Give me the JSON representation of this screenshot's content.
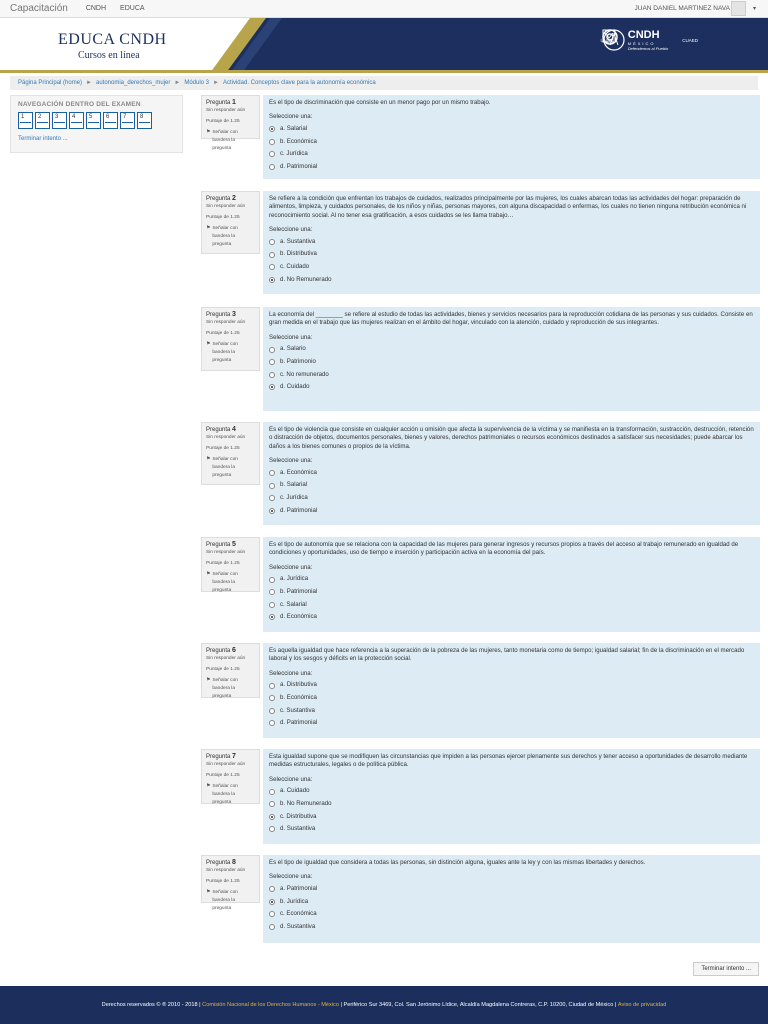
{
  "topbar": {
    "brand": "Capacitación",
    "links": [
      "CNDH",
      "EDUCA"
    ],
    "user": "JUAN DANIEL MARTINEZ NAVA"
  },
  "banner": {
    "title": "EDUCA CNDH",
    "subtitle": "Cursos en línea",
    "logos": [
      "UNAM",
      "CNDH",
      "MÉXICO",
      "Defendemos al Pueblo",
      "CUAED"
    ],
    "accent": "#b8a44a",
    "navy": "#1d2f5e"
  },
  "breadcrumb": [
    "Página Principal (home)",
    "autonomia_derechos_mujer",
    "Módulo 3",
    "Actividad. Conceptos clave para la autonomía económica"
  ],
  "quiznav": {
    "title": "NAVEGACIÓN DENTRO DEL EXAMEN",
    "buttons": [
      "1",
      "2",
      "3",
      "4",
      "5",
      "6",
      "7",
      "8"
    ],
    "finish_link": "Terminar intento ..."
  },
  "common": {
    "status": "Sin responder aún",
    "score": "Puntaje de 1.25",
    "flag": "Señalar con bandera la pregunta",
    "prompt": "Seleccione una:"
  },
  "questions": [
    {
      "label": "Pregunta",
      "number": "1",
      "text": "Es el tipo de discriminación que consiste en un menor pago por un mismo trabajo.",
      "options": [
        "a. Salarial",
        "b. Económica",
        "c. Jurídica",
        "d. Patrimonial"
      ],
      "selected": 0
    },
    {
      "label": "Pregunta",
      "number": "2",
      "text": "Se refiere a la condición que enfrentan los trabajos de cuidados, realizados principalmente por las mujeres, los cuales abarcan todas las actividades del hogar: preparación de alimentos, limpieza, y cuidados personales, de los niños y niñas, personas mayores, con alguna discapacidad o enfermas, los cuales no tienen ninguna retribución económica ni reconocimiento social. Al no tener esa gratificación, a esos cuidados se les llama trabajo…",
      "options": [
        "a. Sustantiva",
        "b. Distributiva",
        "c. Cuidado",
        "d. No Remunerado"
      ],
      "selected": 3
    },
    {
      "label": "Pregunta",
      "number": "3",
      "text": "La economía del ________ se refiere al estudio de todas las actividades, bienes y servicios necesarios para la reproducción cotidiana de las personas y sus cuidados.  Consiste en gran medida en el trabajo que las mujeres realizan en el ámbito del hogar, vinculado con la atención, cuidado y reproducción de sus integrantes.",
      "options": [
        "a. Salario",
        "b. Patrimonio",
        "c. No remunerado",
        "d. Cuidado"
      ],
      "selected": 3
    },
    {
      "label": "Pregunta",
      "number": "4",
      "text": "Es el tipo de violencia que consiste en cualquier acción u omisión que afecta la supervivencia de la víctima y se manifiesta en la transformación, sustracción, destrucción, retención o distracción de objetos, documentos personales, bienes y valores, derechos patrimoniales o recursos económicos destinados a satisfacer sus necesidades; puede abarcar los daños a los bienes comunes o propios de la víctima.",
      "options": [
        "a. Económica",
        "b. Salarial",
        "c. Jurídica",
        "d. Patrimonial"
      ],
      "selected": 3
    },
    {
      "label": "Pregunta",
      "number": "5",
      "text": "Es el tipo de autonomía que se relaciona con la capacidad de las mujeres para generar ingresos y recursos propios a través del acceso al trabajo remunerado en igualdad de condiciones y oportunidades, uso de tiempo e inserción y participación activa en la economía del país.",
      "options": [
        "a. Jurídica",
        "b. Patrimonial",
        "c. Salarial",
        "d. Económica"
      ],
      "selected": 3
    },
    {
      "label": "Pregunta",
      "number": "6",
      "text": "Es aquella igualdad que hace referencia a la superación de la pobreza de las mujeres, tanto monetaria como de tiempo; igualdad salarial; fin de la discriminación en el mercado laboral y los sesgos y déficits en la protección social.",
      "options": [
        "a. Distributiva",
        "b. Económica",
        "c. Sustantiva",
        "d. Patrimonial"
      ],
      "selected": -1
    },
    {
      "label": "Pregunta",
      "number": "7",
      "text": "Esta igualdad supone que se modifiquen las circunstancias que impiden a las personas ejercer plenamente sus derechos y tener acceso a oportunidades de desarrollo mediante medidas estructurales, legales o de política pública.",
      "options": [
        "a. Cuidado",
        "b. No Remunerado",
        "c. Distributiva",
        "d. Sustantiva"
      ],
      "selected": 2
    },
    {
      "label": "Pregunta",
      "number": "8",
      "text": "Es el tipo de igualdad que considera a todas las personas, sin distinción alguna, iguales ante la ley y con las mismas libertades y derechos.",
      "options": [
        "a. Patrimonial",
        "b. Jurídica",
        "c. Económica",
        "d. Sustantiva"
      ],
      "selected": 1
    }
  ],
  "finish_button": "Terminar intento ...",
  "footer": {
    "rights": "Derechos reservados © ® 2010 - 2018 |",
    "org": "Comisión Nacional de los Derechos Humanos - México",
    "address": "| Periférico Sur 3469, Col. San Jerónimo Lídice, Alcaldía Magdalena Contreras, C.P. 10200, Ciudad de México |",
    "privacy": "Aviso de privacidad"
  }
}
